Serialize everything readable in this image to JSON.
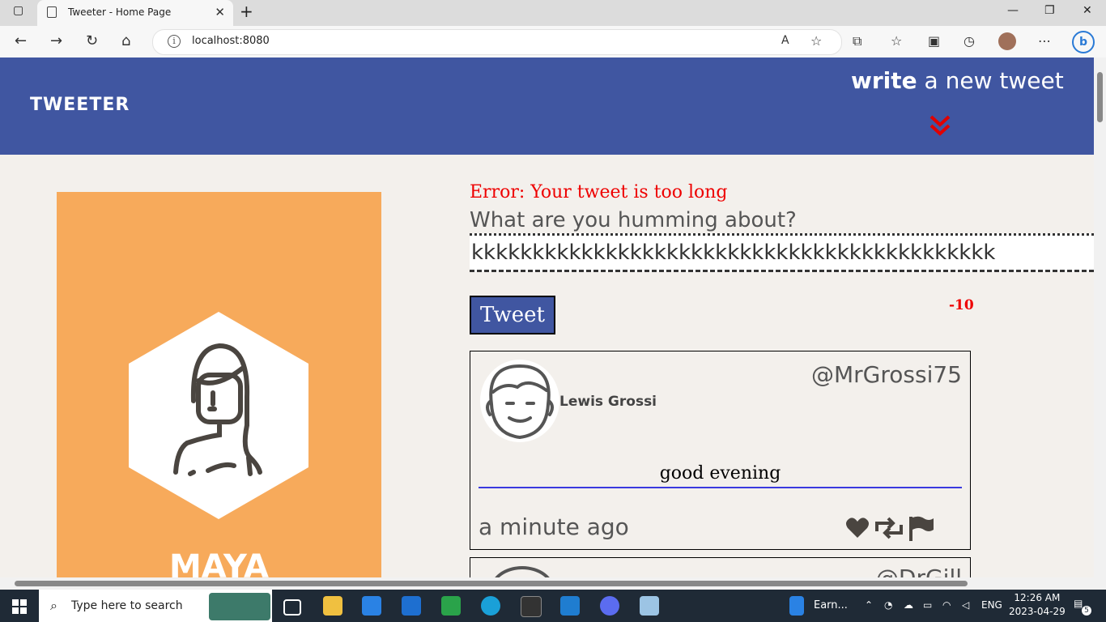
{
  "browser": {
    "tab_title": "Tweeter - Home Page",
    "url": "localhost:8080"
  },
  "header": {
    "brand": "TWEETER",
    "write_bold": "write",
    "write_rest": " a new tweet",
    "accent_color": "#4056a1",
    "chevron_color": "#e00000"
  },
  "profile": {
    "name": "MAYA",
    "bg_color": "#f7aa5b"
  },
  "compose": {
    "error": "Error: Your tweet is too long",
    "prompt": "What are you humming about?",
    "value": "kkkkkkkkkkkkkkkkkkkkkkkkkkkkkkkkkkkkkkkkkkk",
    "button": "Tweet",
    "counter": "-10"
  },
  "tweets": [
    {
      "name": "Lewis Grossi",
      "handle": "@MrGrossi75",
      "content": "good evening",
      "time": "a minute ago",
      "icons": [
        "heart-icon",
        "retweet-icon",
        "flag-icon"
      ]
    },
    {
      "handle": "@DrGill"
    }
  ],
  "taskbar": {
    "search_placeholder": "Type here to search",
    "earnings_label": "Earn...",
    "language": "ENG",
    "time": "12:26 AM",
    "date": "2023-04-29",
    "notification_count": "5"
  }
}
